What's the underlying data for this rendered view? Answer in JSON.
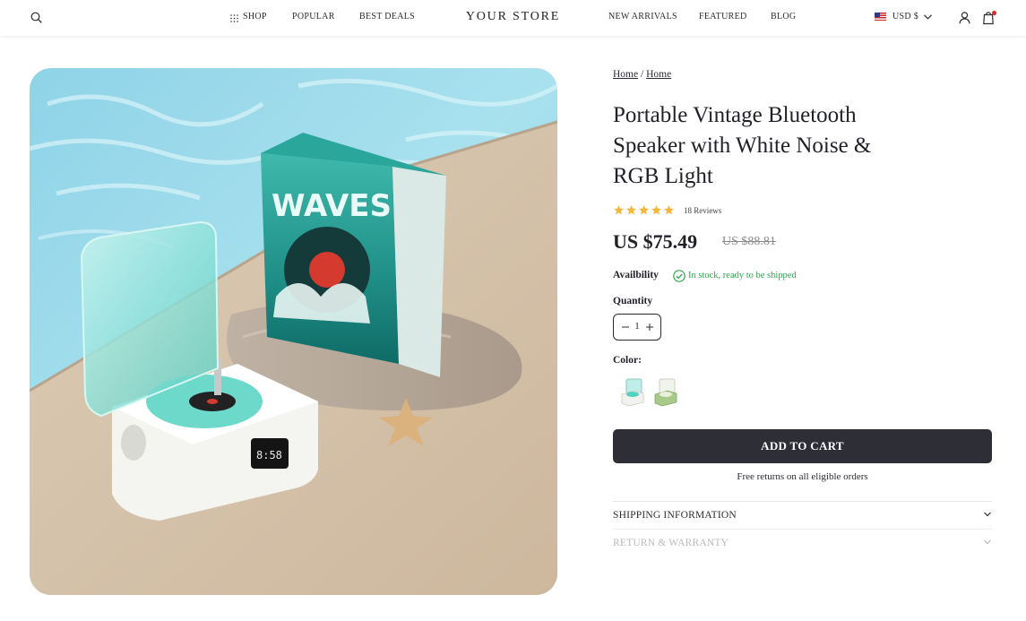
{
  "header": {
    "store_name": "YOUR STORE",
    "nav_left": [
      "SHOP",
      "POPULAR",
      "BEST DEALS"
    ],
    "nav_right": [
      "NEW ARRIVALS",
      "FEATURED",
      "BLOG"
    ],
    "currency": "USD $",
    "icons": [
      "search-icon",
      "grid-icon",
      "flag-us-icon",
      "chevron-down-icon",
      "account-icon",
      "cart-icon"
    ]
  },
  "breadcrumb": {
    "items": [
      "Home",
      "Home"
    ],
    "separator": "/"
  },
  "product": {
    "title": "Portable Vintage Bluetooth Speaker with White Noise & RGB Light",
    "rating": 5,
    "reviews": "18 Reviews",
    "price": "US $75.49",
    "compare_price": "US $88.81",
    "availability_label": "Availbility",
    "availability_status": "In stock, ready to be shipped",
    "quantity_label": "Quantity",
    "quantity": "1",
    "color_label": "Color:",
    "color_options": [
      "teal",
      "green"
    ],
    "add_to_cart": "ADD TO CART",
    "free_returns": "Free returns on all eligible orders",
    "image_box_text": "WAVES"
  },
  "accordion": {
    "shipping": "SHIPPING INFORMATION",
    "returns": "RETURN & WARRANTY"
  },
  "colors": {
    "primary_dark": "#2d2e36",
    "star": "#f4b73e",
    "in_stock": "#2fa84f",
    "notification": "#e03131"
  }
}
